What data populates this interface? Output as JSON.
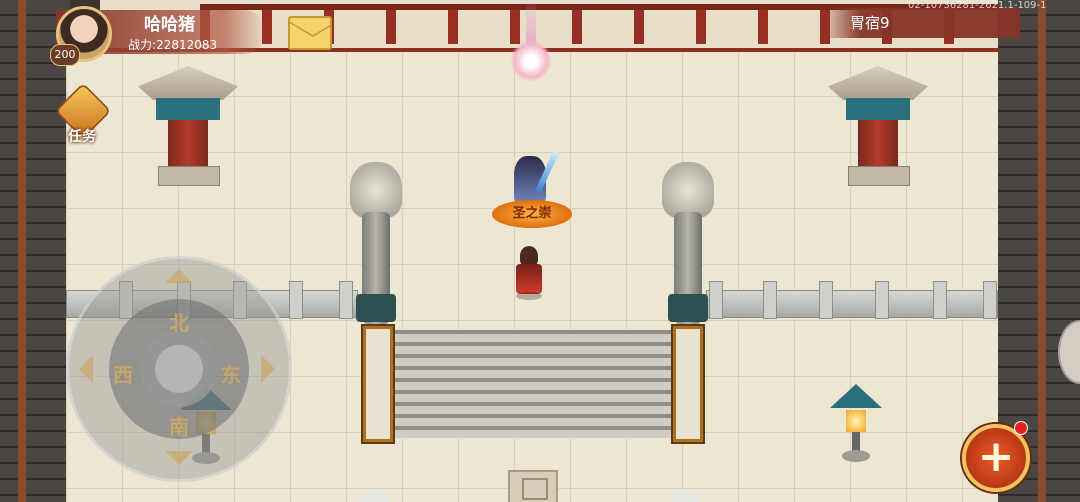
{
  "player": {
    "name": "哈哈猪",
    "power_label": "战力:22812083",
    "level": "200"
  },
  "task": {
    "label": "任务"
  },
  "map": {
    "name": "胃宿9",
    "server_id": "02-10736281-2621.1-109-1"
  },
  "npc": {
    "title": "圣之崇"
  },
  "joystick": {
    "north": "北",
    "south": "南",
    "east": "东",
    "west": "西"
  },
  "actions": {
    "expand_symbol": "+"
  },
  "icons": {
    "mail": "mail-icon",
    "task": "scroll-quest-icon",
    "expand": "plus-icon"
  },
  "colors": {
    "accent": "#b33b2a",
    "gold": "#f0c35e"
  }
}
